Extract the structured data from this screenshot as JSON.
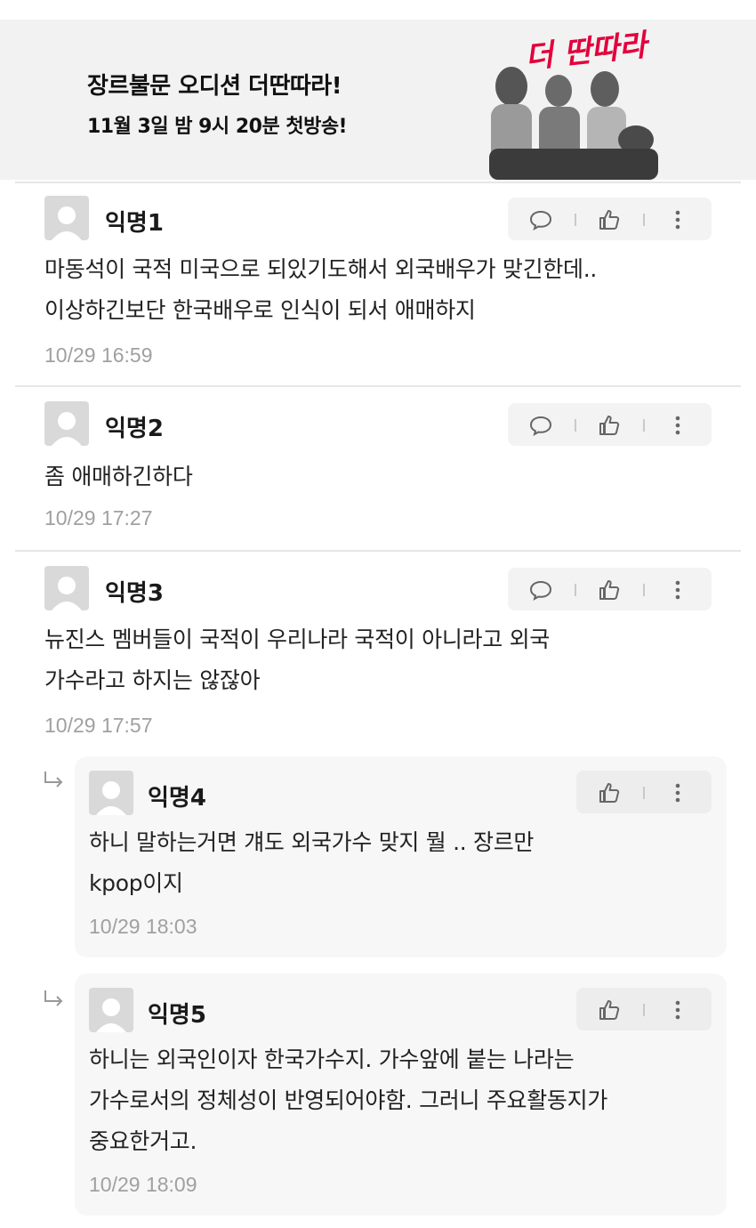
{
  "banner": {
    "line1": "장르불문 오디션 더딴따라!",
    "line2": "11월 3일 밤 9시 20분 첫방송!",
    "logo_text": "더 딴따라"
  },
  "comments": [
    {
      "author": "익명1",
      "body": "마동석이 국적 미국으로 되있기도해서 외국배우가 맞긴한데..\n이상하긴보단 한국배우로 인식이 되서 애매하지",
      "time": "10/29 16:59"
    },
    {
      "author": "익명2",
      "body": "좀 애매하긴하다",
      "time": "10/29 17:27"
    },
    {
      "author": "익명3",
      "body": "뉴진스 멤버들이 국적이 우리나라 국적이 아니라고 외국\n가수라고 하지는 않잖아",
      "time": "10/29 17:57"
    }
  ],
  "replies": [
    {
      "author": "익명4",
      "body": "하니 말하는거면 걔도 외국가수 맞지 뭘 .. 장르만\nkpop이지",
      "time": "10/29 18:03"
    },
    {
      "author": "익명5",
      "body": "하니는 외국인이자 한국가수지. 가수앞에 붙는 나라는\n가수로서의 정체성이 반영되어야함. 그러니 주요활동지가\n중요한거고.",
      "time": "10/29 18:09"
    }
  ],
  "icons": {
    "reply": "speech-bubble-icon",
    "like": "thumbs-up-icon",
    "more": "vertical-dots-icon",
    "avatar": "default-user-icon",
    "reply_indicator": "reply-arrow-icon"
  },
  "colors": {
    "banner_bg": "#f2f2f2",
    "logo_red": "#e2003c",
    "time_gray": "#a0a0a0",
    "reply_card_bg": "#f7f7f7",
    "action_bg": "#f3f3f3"
  }
}
